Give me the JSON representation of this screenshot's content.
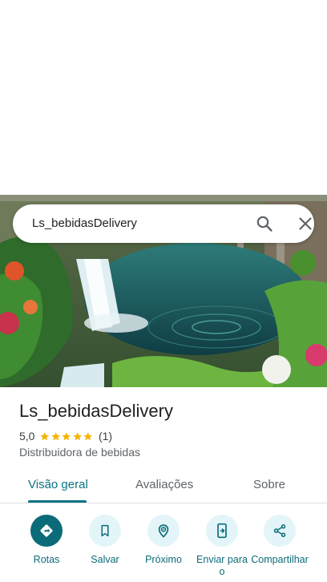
{
  "search": {
    "query": "Ls_bebidasDelivery"
  },
  "place": {
    "name": "Ls_bebidasDelivery",
    "rating": "5,0",
    "review_count": "(1)",
    "stars": 5,
    "category": "Distribuidora de bebidas"
  },
  "tabs": [
    {
      "label": "Visão geral",
      "selected": true
    },
    {
      "label": "Avaliações",
      "selected": false
    },
    {
      "label": "Sobre",
      "selected": false
    }
  ],
  "actions": [
    {
      "label": "Rotas",
      "icon": "directions-icon"
    },
    {
      "label": "Salvar",
      "icon": "bookmark-icon"
    },
    {
      "label": "Próximo",
      "icon": "nearby-icon"
    },
    {
      "label": "Enviar para o",
      "icon": "send-to-phone-icon"
    },
    {
      "label": "Compartilhar",
      "icon": "share-icon"
    }
  ],
  "colors": {
    "accent": "#0b7285",
    "action_bg": "#e3f5f8",
    "star": "#f4b400"
  }
}
